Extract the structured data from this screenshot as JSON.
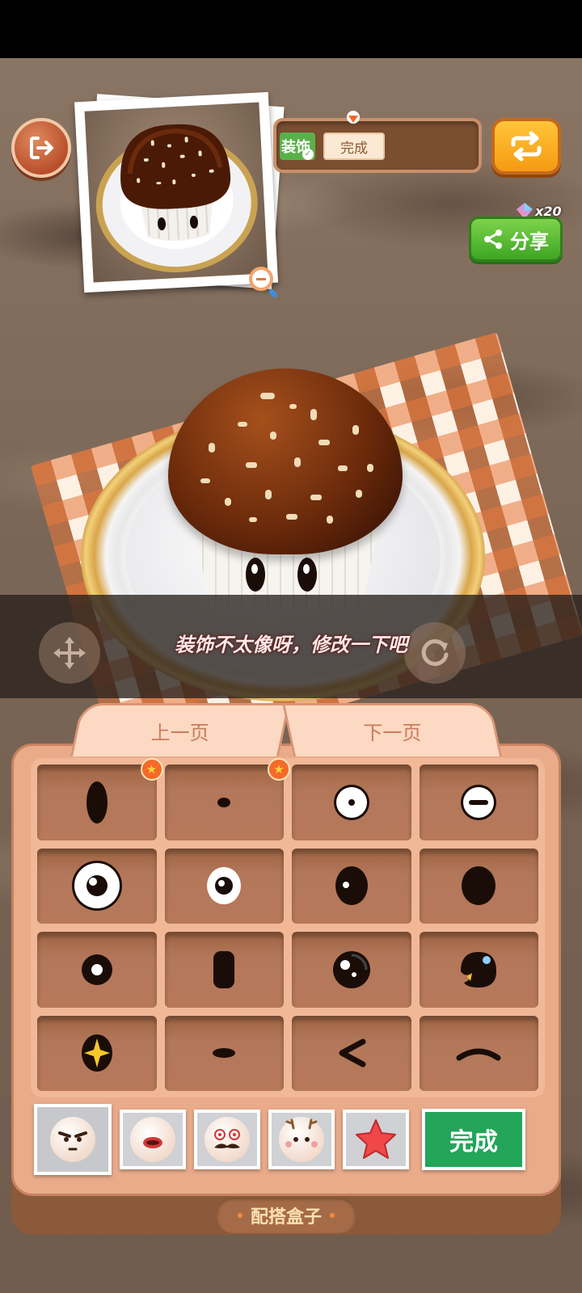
{
  "progress": {
    "step_decorate": "装饰",
    "step_done": "完成"
  },
  "share": {
    "gem_count": "x20",
    "label": "分享"
  },
  "hint": {
    "message": "装饰不太像呀，修改一下吧"
  },
  "box": {
    "prev_page": "上一页",
    "next_page": "下一页",
    "title": "配搭盒子",
    "done_button": "完成"
  },
  "eye_items": [
    {
      "icon": "tall-oval-eye-icon",
      "starred": true
    },
    {
      "icon": "dot-eye-icon",
      "starred": true
    },
    {
      "icon": "white-round-eye-icon",
      "starred": false
    },
    {
      "icon": "sleepy-round-eye-icon",
      "starred": false
    },
    {
      "icon": "big-white-eye-icon",
      "starred": false
    },
    {
      "icon": "medium-white-eye-icon",
      "starred": false
    },
    {
      "icon": "oval-shine-eye-icon",
      "starred": false
    },
    {
      "icon": "big-oval-eye-icon",
      "starred": false
    },
    {
      "icon": "ring-eye-icon",
      "starred": false
    },
    {
      "icon": "rect-eye-icon",
      "starred": false
    },
    {
      "icon": "sparkle-round-eye-icon",
      "starred": false
    },
    {
      "icon": "cute-shine-eye-icon",
      "starred": false
    },
    {
      "icon": "star-eye-icon",
      "starred": false
    },
    {
      "icon": "dash-eye-icon",
      "starred": false
    },
    {
      "icon": "less-than-eye-icon",
      "starred": false
    },
    {
      "icon": "closed-arc-eye-icon",
      "starred": false
    }
  ],
  "categories": [
    {
      "icon": "eyebrow-face-icon",
      "selected": true
    },
    {
      "icon": "mouth-face-icon",
      "selected": false
    },
    {
      "icon": "mustache-face-icon",
      "selected": false
    },
    {
      "icon": "antler-face-icon",
      "selected": false
    },
    {
      "icon": "star-decor-icon",
      "selected": false
    }
  ],
  "colors": {
    "share_green": "#3da624",
    "done_green": "#23a55a",
    "swap_orange": "#f59a12",
    "box_peach": "#e9ab8a"
  }
}
